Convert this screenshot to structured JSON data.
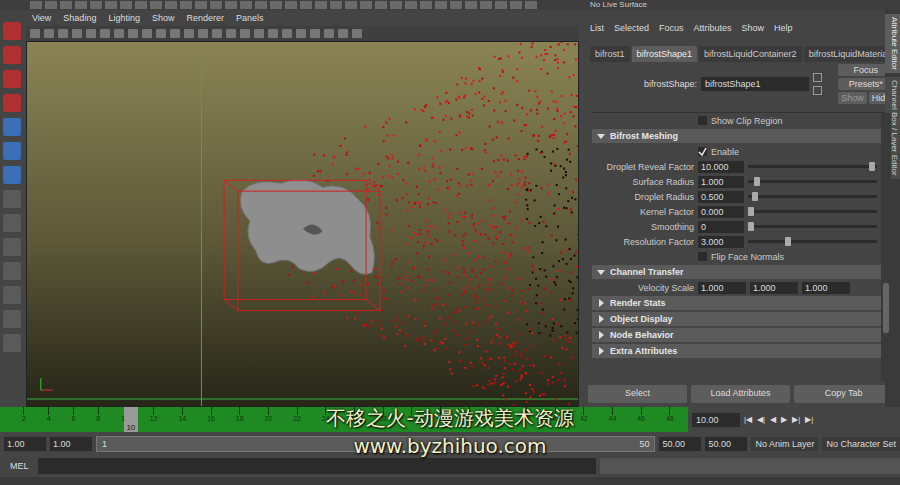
{
  "toolbar": {
    "live_surface": "No Live Surface"
  },
  "viewport": {
    "menu": [
      "View",
      "Shading",
      "Lighting",
      "Show",
      "Renderer",
      "Panels"
    ]
  },
  "attribute_editor": {
    "menu": [
      "List",
      "Selected",
      "Focus",
      "Attributes",
      "Show",
      "Help"
    ],
    "tabs": [
      {
        "label": "bifrost1",
        "selected": false
      },
      {
        "label": "bifrostShape1",
        "selected": true
      },
      {
        "label": "bifrostLiquidContainer2",
        "selected": false
      },
      {
        "label": "bifrostLiquidMaterial6",
        "selected": false
      }
    ],
    "node": {
      "label": "bifrostShape:",
      "value": "bifrostShape1"
    },
    "buttons": [
      "Focus",
      "Presets*",
      "Show",
      "Hide"
    ],
    "attributes": [
      {
        "kind": "checkbox",
        "label": "Show Clip Region",
        "checked": false
      },
      {
        "kind": "section",
        "label": "Bifrost Meshing",
        "expanded": true
      },
      {
        "kind": "checkbox",
        "label": "Enable",
        "checked": true
      },
      {
        "kind": "slider",
        "label": "Droplet Reveal Factor",
        "value": "10.000",
        "level": 0.98
      },
      {
        "kind": "slider",
        "label": "Surface Radius",
        "value": "1.000",
        "level": 0.05
      },
      {
        "kind": "slider",
        "label": "Droplet Radius",
        "value": "0.500",
        "level": 0.03
      },
      {
        "kind": "slider",
        "label": "Kernel Factor",
        "value": "0.000",
        "level": 0.0
      },
      {
        "kind": "slider",
        "label": "Smoothing",
        "value": "0",
        "level": 0.0
      },
      {
        "kind": "slider",
        "label": "Resolution Factor",
        "value": "3.000",
        "level": 0.3
      },
      {
        "kind": "checkbox",
        "label": "Flip Face Normals",
        "checked": false
      },
      {
        "kind": "section",
        "label": "Channel Transfer",
        "expanded": true
      },
      {
        "kind": "vector",
        "label": "Velocity Scale",
        "values": [
          "1.000",
          "1.000",
          "1.000"
        ]
      },
      {
        "kind": "section",
        "label": "Render Stats",
        "expanded": false
      },
      {
        "kind": "section",
        "label": "Object Display",
        "expanded": false
      },
      {
        "kind": "section",
        "label": "Node Behavior",
        "expanded": false
      },
      {
        "kind": "section",
        "label": "Extra Attributes",
        "expanded": false
      }
    ],
    "footer_buttons": [
      "Select",
      "Load Attributes",
      "Copy Tab"
    ]
  },
  "side_tabs": [
    "Attribute Editor",
    "Channel Box / Layer Editor"
  ],
  "timeline": {
    "ticks": [
      "2",
      "4",
      "6",
      "8",
      "10",
      "12",
      "14",
      "16",
      "18",
      "20",
      "22",
      "24",
      "26",
      "28",
      "30",
      "32",
      "34",
      "36",
      "38",
      "40",
      "42",
      "44",
      "46",
      "48"
    ],
    "current": "10",
    "level": 0.18,
    "frame": "10.00",
    "controls": [
      "|◀",
      "◀|",
      "◀",
      "▶",
      "▶|",
      "▶|"
    ]
  },
  "range": {
    "start": "1.00",
    "inner_start": "1.00",
    "min": "1",
    "max": "50",
    "inner_end": "50.00",
    "end": "50.00"
  },
  "anim_layer": "No Anim Layer",
  "character_set": "No Character Set",
  "command_line": {
    "label": "MEL"
  },
  "watermark": [
    "不移之火-动漫游戏美术资源",
    "www.byzhihuo.com"
  ]
}
